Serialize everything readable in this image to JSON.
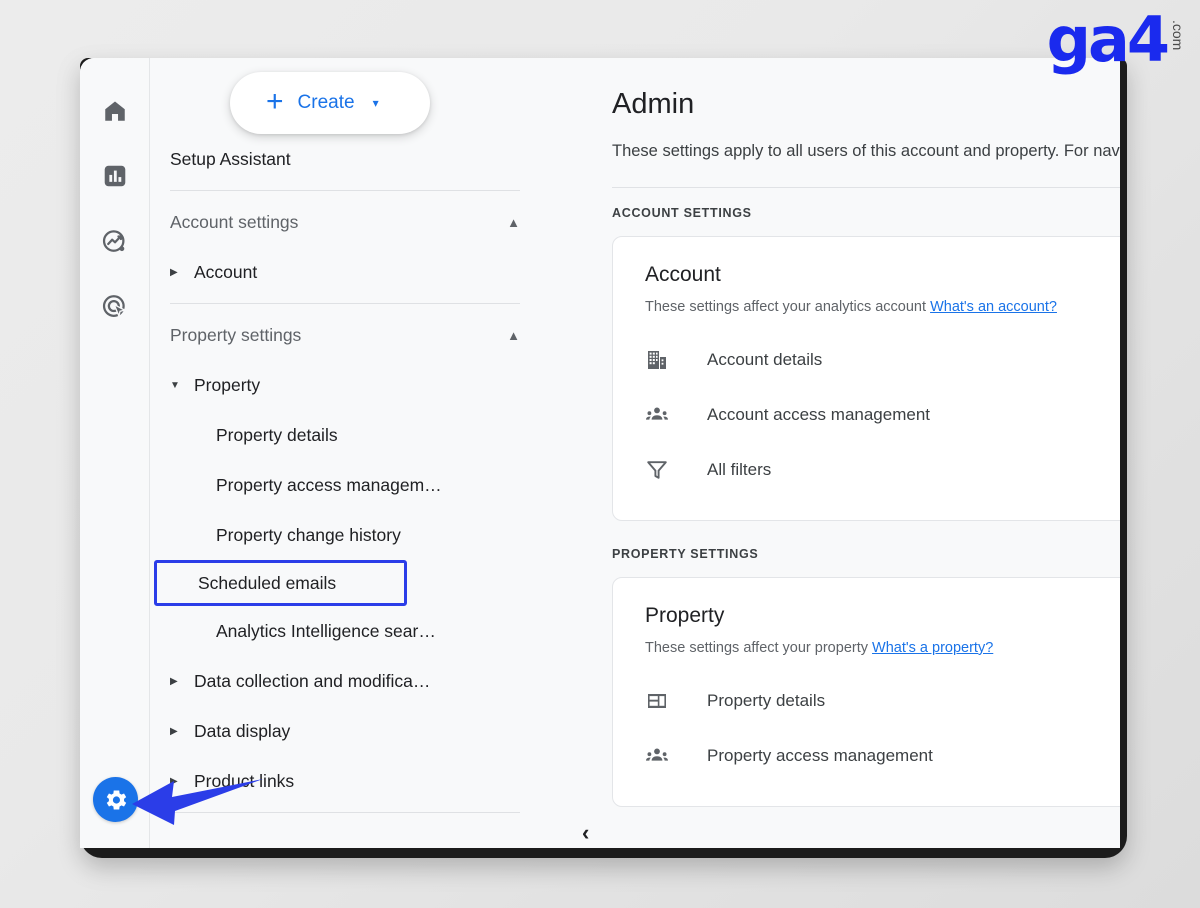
{
  "logo": {
    "wordmark": "ga4",
    "suffix": ".com",
    "color": "#1a2aee"
  },
  "icon_rail": {
    "items": [
      {
        "name": "home-icon",
        "label": "Home"
      },
      {
        "name": "reports-icon",
        "label": "Reports"
      },
      {
        "name": "explore-icon",
        "label": "Explore"
      },
      {
        "name": "advertising-icon",
        "label": "Advertising"
      }
    ],
    "settings_button": {
      "name": "gear-icon",
      "label": "Admin",
      "color": "#1a73e8"
    }
  },
  "sidebar": {
    "create_button": {
      "label": "Create",
      "plus": "+",
      "caret": "▾"
    },
    "setup_assistant": "Setup Assistant",
    "account_settings": {
      "label": "Account settings",
      "chevron": "⌃",
      "items": [
        {
          "label": "Account",
          "expanded": false,
          "marker": "▸"
        }
      ]
    },
    "property_settings": {
      "label": "Property settings",
      "chevron": "⌃",
      "property": {
        "label": "Property",
        "expanded": true,
        "marker": "▾"
      },
      "sub_items": [
        {
          "label": "Property details",
          "highlighted": false
        },
        {
          "label": "Property access managem…",
          "highlighted": false
        },
        {
          "label": "Property change history",
          "highlighted": false
        },
        {
          "label": "Scheduled emails",
          "highlighted": true
        },
        {
          "label": "Analytics Intelligence sear…",
          "highlighted": false
        }
      ],
      "groups": [
        {
          "label": "Data collection and modifica…",
          "marker": "▸"
        },
        {
          "label": "Data display",
          "marker": "▸"
        },
        {
          "label": "Product links",
          "marker": "▸"
        }
      ]
    },
    "collapse_chevron": "‹",
    "highlight_color": "#2b3de8"
  },
  "main": {
    "title": "Admin",
    "description": "These settings apply to all users of this account and property. For",
    "description_line2": "navigation.",
    "sections": [
      {
        "label": "ACCOUNT SETTINGS",
        "card": {
          "title": "Account",
          "subtitle": "These settings affect your analytics account",
          "link": "What's an account?",
          "rows": [
            {
              "label": "Account details",
              "icon": "building-icon",
              "help": "help-icon"
            },
            {
              "label": "Account access management",
              "icon": "people-group-icon",
              "help": "help-icon"
            },
            {
              "label": "All filters",
              "icon": "funnel-icon",
              "help": "help-icon"
            }
          ]
        }
      },
      {
        "label": "PROPERTY SETTINGS",
        "card": {
          "title": "Property",
          "subtitle": "These settings affect your property",
          "link": "What's a property?",
          "rows": [
            {
              "label": "Property details",
              "icon": "layout-icon",
              "help": "help-icon"
            },
            {
              "label": "Property access management",
              "icon": "people-group-icon",
              "help": "help-icon"
            }
          ]
        }
      }
    ]
  },
  "annotation": {
    "arrow": {
      "name": "pointer-arrow",
      "color": "#2b3de8",
      "points_to": "gear-icon"
    }
  }
}
